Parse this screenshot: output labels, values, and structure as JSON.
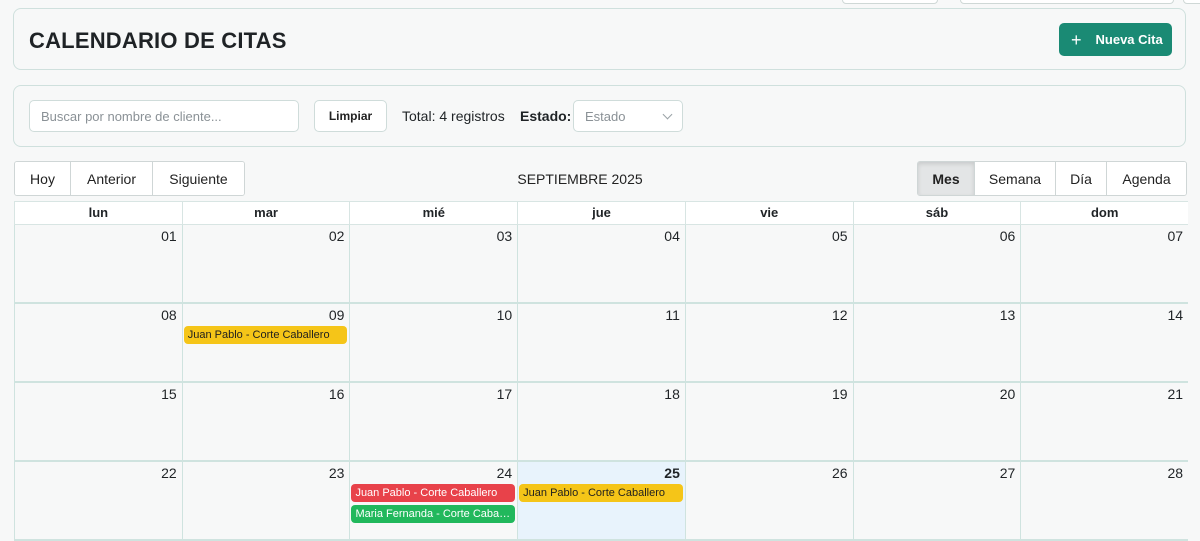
{
  "header": {
    "title": "CALENDARIO DE CITAS",
    "new_button_label": "Nueva Cita"
  },
  "filters": {
    "search_placeholder": "Buscar por nombre de cliente...",
    "search_value": "",
    "clear_label": "Limpiar",
    "total_text": "Total: 4 registros",
    "estado_label": "Estado:",
    "estado_selected": "Estado"
  },
  "toolbar": {
    "nav": [
      "Hoy",
      "Anterior",
      "Siguiente"
    ],
    "month_label": "SEPTIEMBRE 2025",
    "views": [
      "Mes",
      "Semana",
      "Día",
      "Agenda"
    ],
    "active_view": "Mes"
  },
  "calendar": {
    "weekdays": [
      "lun",
      "mar",
      "mié",
      "jue",
      "vie",
      "sáb",
      "dom"
    ],
    "weeks": [
      [
        "01",
        "02",
        "03",
        "04",
        "05",
        "06",
        "07"
      ],
      [
        "08",
        "09",
        "10",
        "11",
        "12",
        "13",
        "14"
      ],
      [
        "15",
        "16",
        "17",
        "18",
        "19",
        "20",
        "21"
      ],
      [
        "22",
        "23",
        "24",
        "25",
        "26",
        "27",
        "28"
      ]
    ],
    "today": "25",
    "events": [
      {
        "week": 1,
        "day": 1,
        "slot": 0,
        "label": "Juan Pablo - Corte Caballero",
        "bg": "#f5c518",
        "fg": "#1f1f1f"
      },
      {
        "week": 3,
        "day": 2,
        "slot": 0,
        "label": "Juan Pablo - Corte Caballero",
        "bg": "#e8424a",
        "fg": "#ffffff"
      },
      {
        "week": 3,
        "day": 2,
        "slot": 1,
        "label": "Maria Fernanda - Corte Caballero",
        "bg": "#21b85c",
        "fg": "#ffffff"
      },
      {
        "week": 3,
        "day": 3,
        "slot": 0,
        "label": "Juan Pablo - Corte Caballero",
        "bg": "#f5c518",
        "fg": "#1f1f1f"
      }
    ]
  },
  "colors": {
    "accent": "#1a8a74",
    "today_bg": "#e8f3fc"
  }
}
